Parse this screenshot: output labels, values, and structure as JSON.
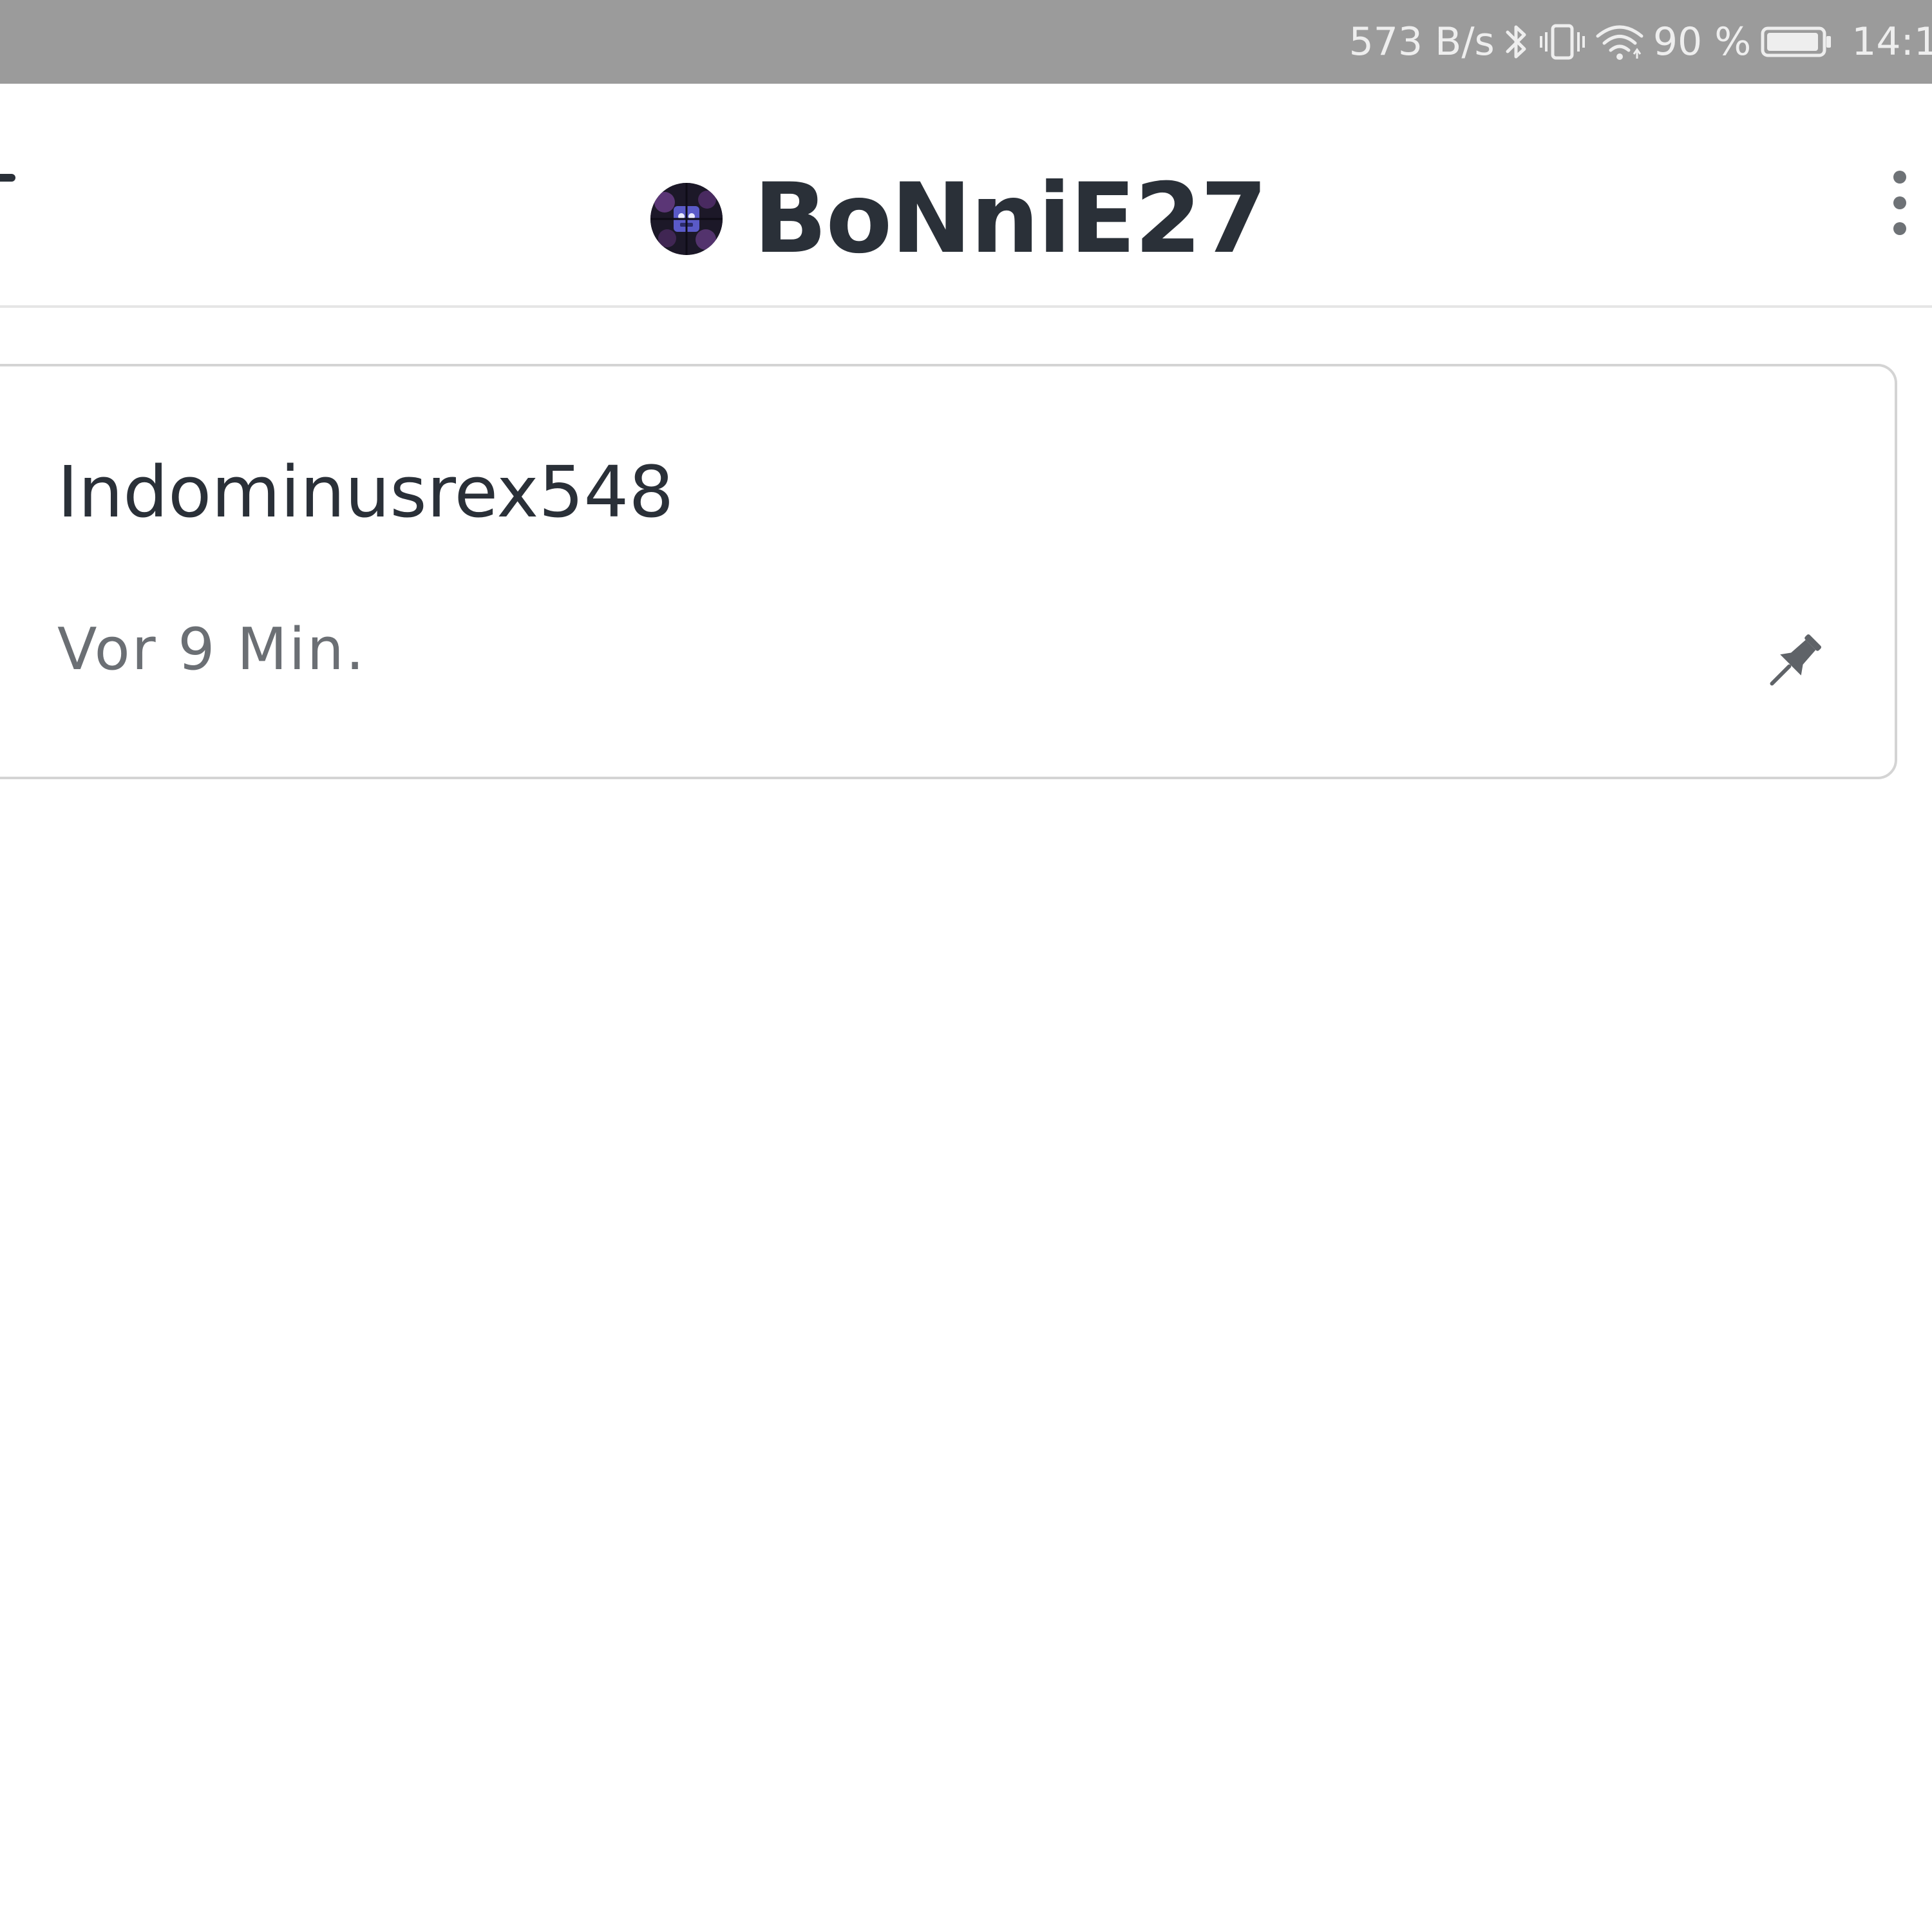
{
  "status_bar": {
    "network_speed": "573 B/s",
    "battery_percent": "90 %",
    "time": "14:1",
    "icons": [
      "bluetooth-icon",
      "vibrate-icon",
      "wifi-icon",
      "battery-icon"
    ]
  },
  "header": {
    "title": "BoNniE27",
    "icons": [
      "back-icon",
      "avatar",
      "more-vert-icon"
    ]
  },
  "card": {
    "title": "Indominusrex548",
    "timestamp": "Vor 9 Min.",
    "icon": "pin-icon"
  },
  "colors": {
    "status_bar_bg": "#9b9b9b",
    "text_primary": "#2a3038",
    "text_secondary": "#6b6f74",
    "card_border": "#d4d4d4"
  }
}
